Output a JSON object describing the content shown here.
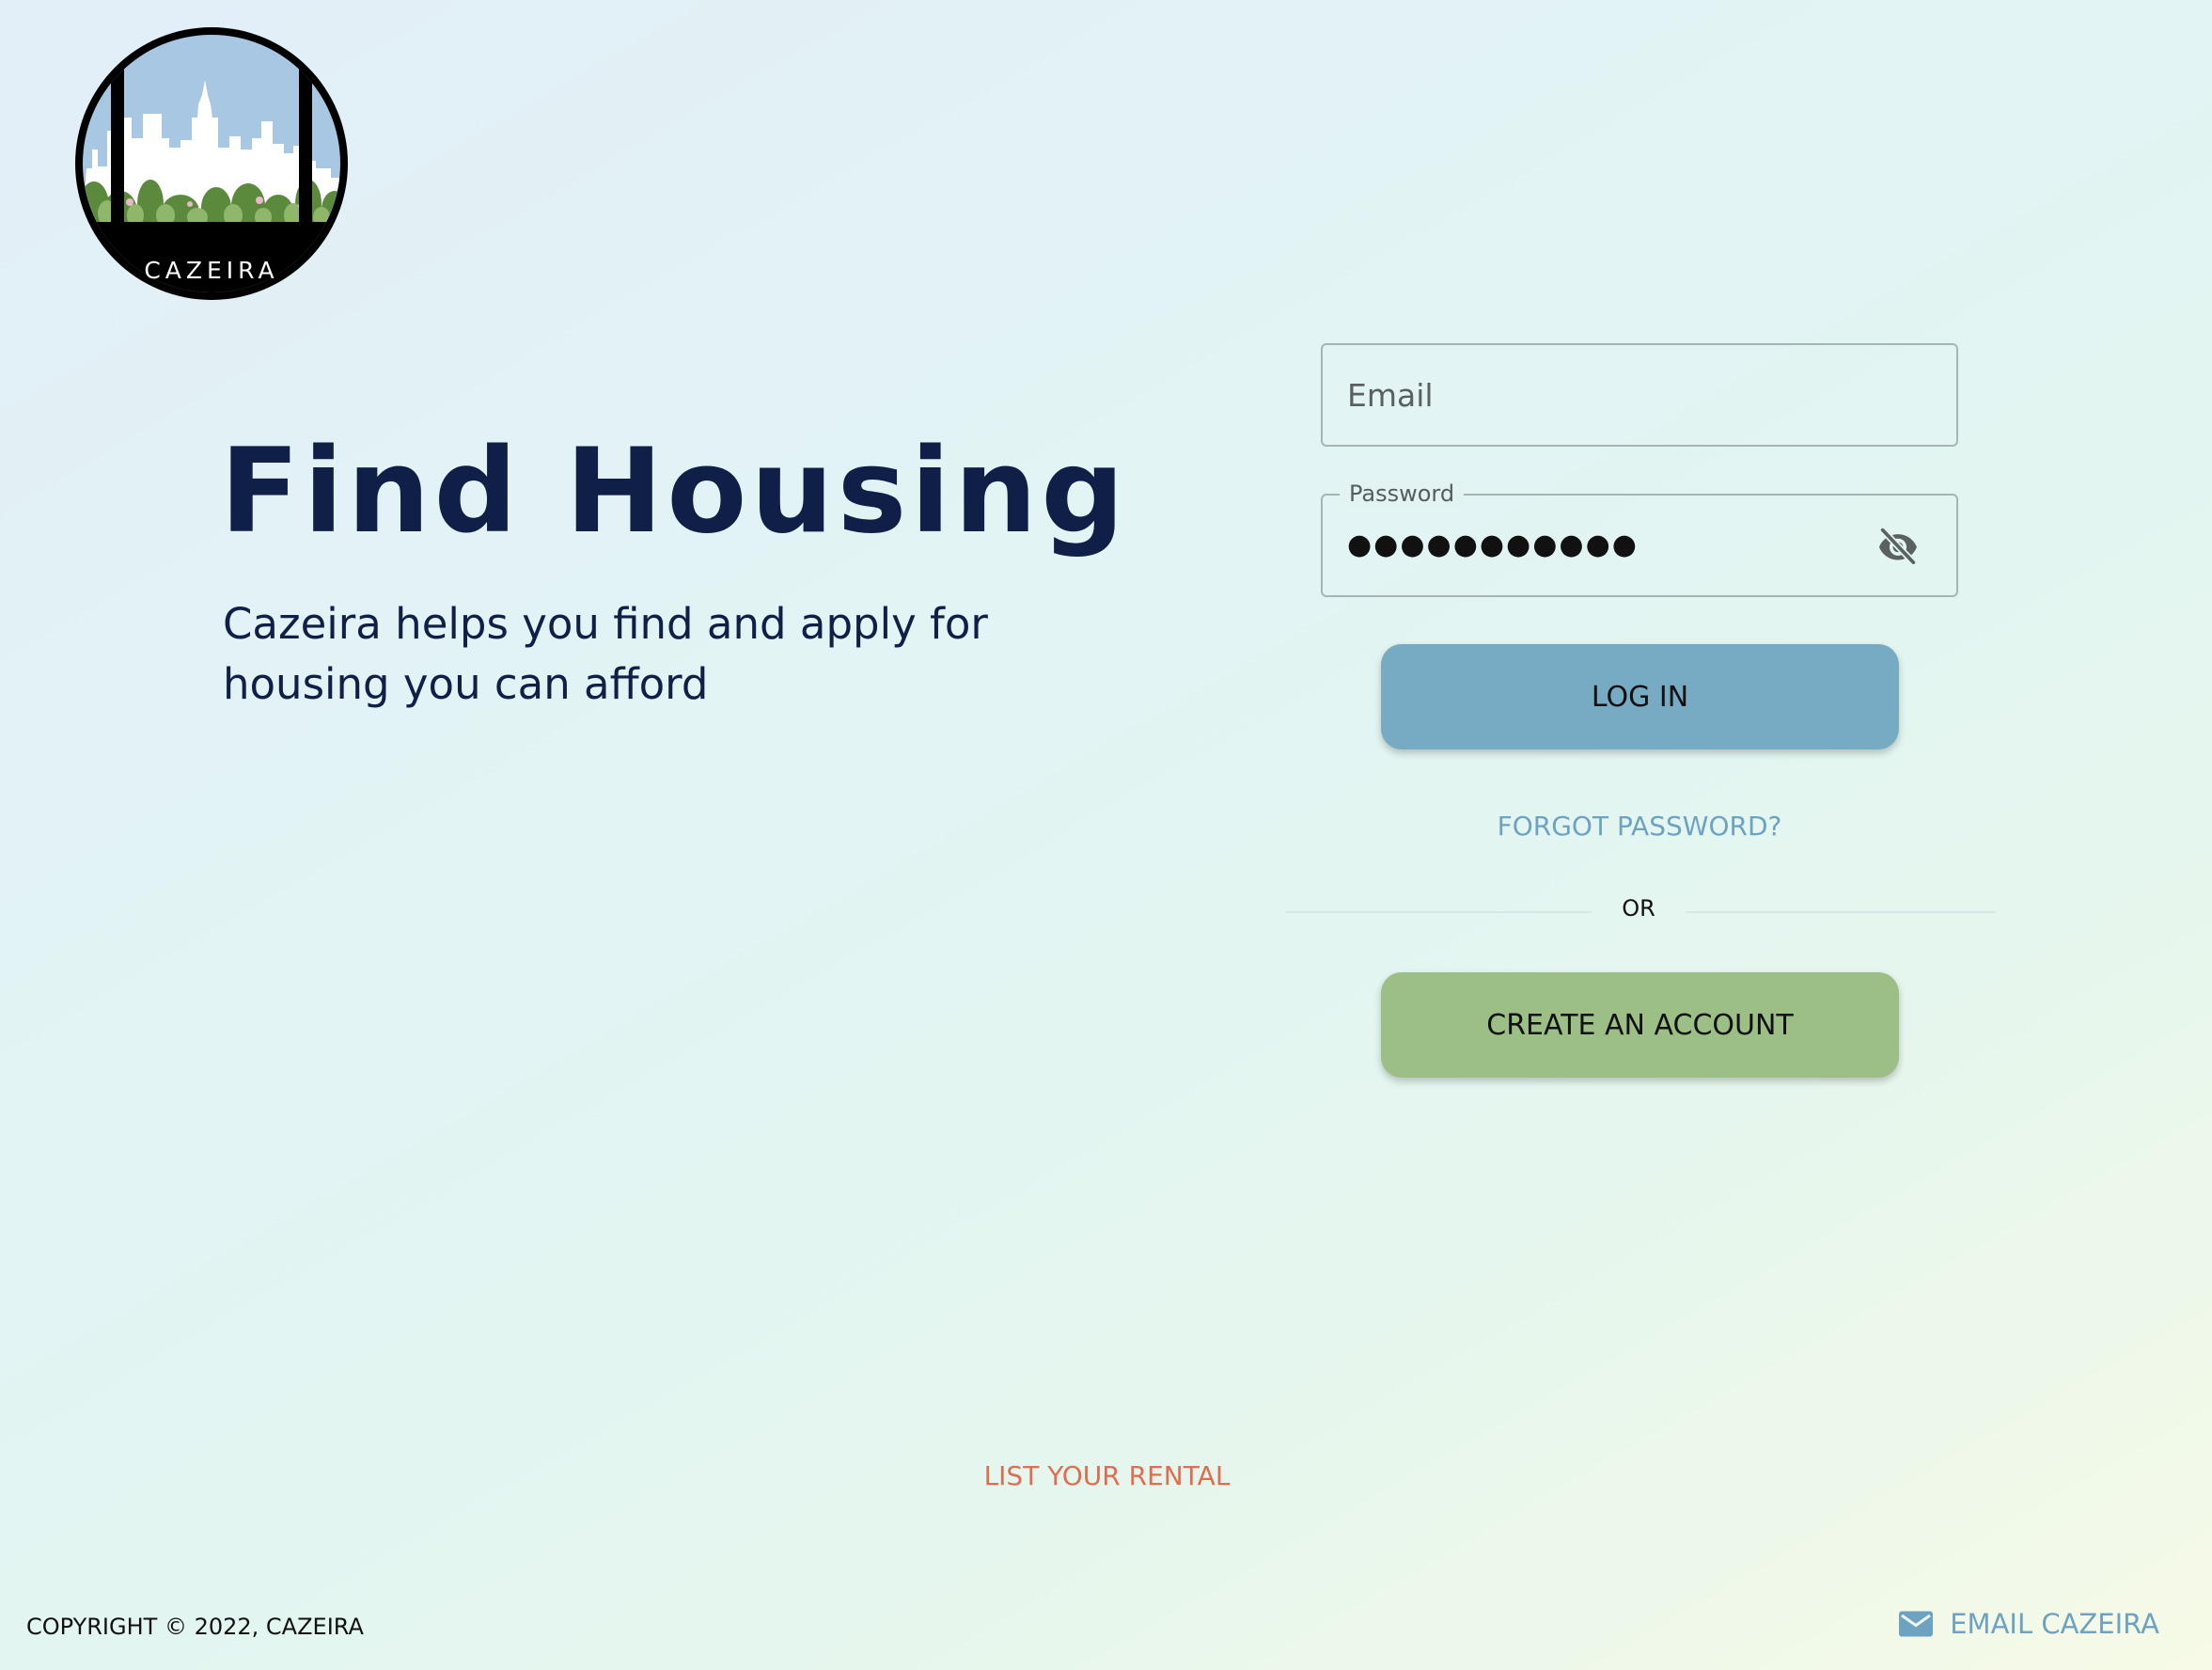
{
  "brand": {
    "logo_text": "CAZEIRA",
    "icon": "cazeira-skyline-logo"
  },
  "hero": {
    "title": "Find Housing",
    "subtitle": "Cazeira helps you find and apply for housing you can afford"
  },
  "login_form": {
    "email": {
      "placeholder": "Email",
      "value": ""
    },
    "password": {
      "label": "Password",
      "masked_value": "●●●●●●●●●●●",
      "visibility_icon": "eye-off-icon"
    },
    "login_label": "LOG IN",
    "forgot_password_label": "FORGOT PASSWORD?",
    "divider_label": "OR",
    "create_account_label": "CREATE AN ACCOUNT"
  },
  "list_rental_label": "LIST YOUR RENTAL",
  "footer": {
    "copyright": "COPYRIGHT © 2022, CAZEIRA",
    "email_label": "EMAIL CAZEIRA",
    "email_icon": "mail-icon"
  },
  "colors": {
    "title": "#0f1f47",
    "login_button": "#77abc4",
    "create_button": "#9bbf84",
    "link_blue": "#6da3c0",
    "link_orange": "#e06d4f"
  }
}
